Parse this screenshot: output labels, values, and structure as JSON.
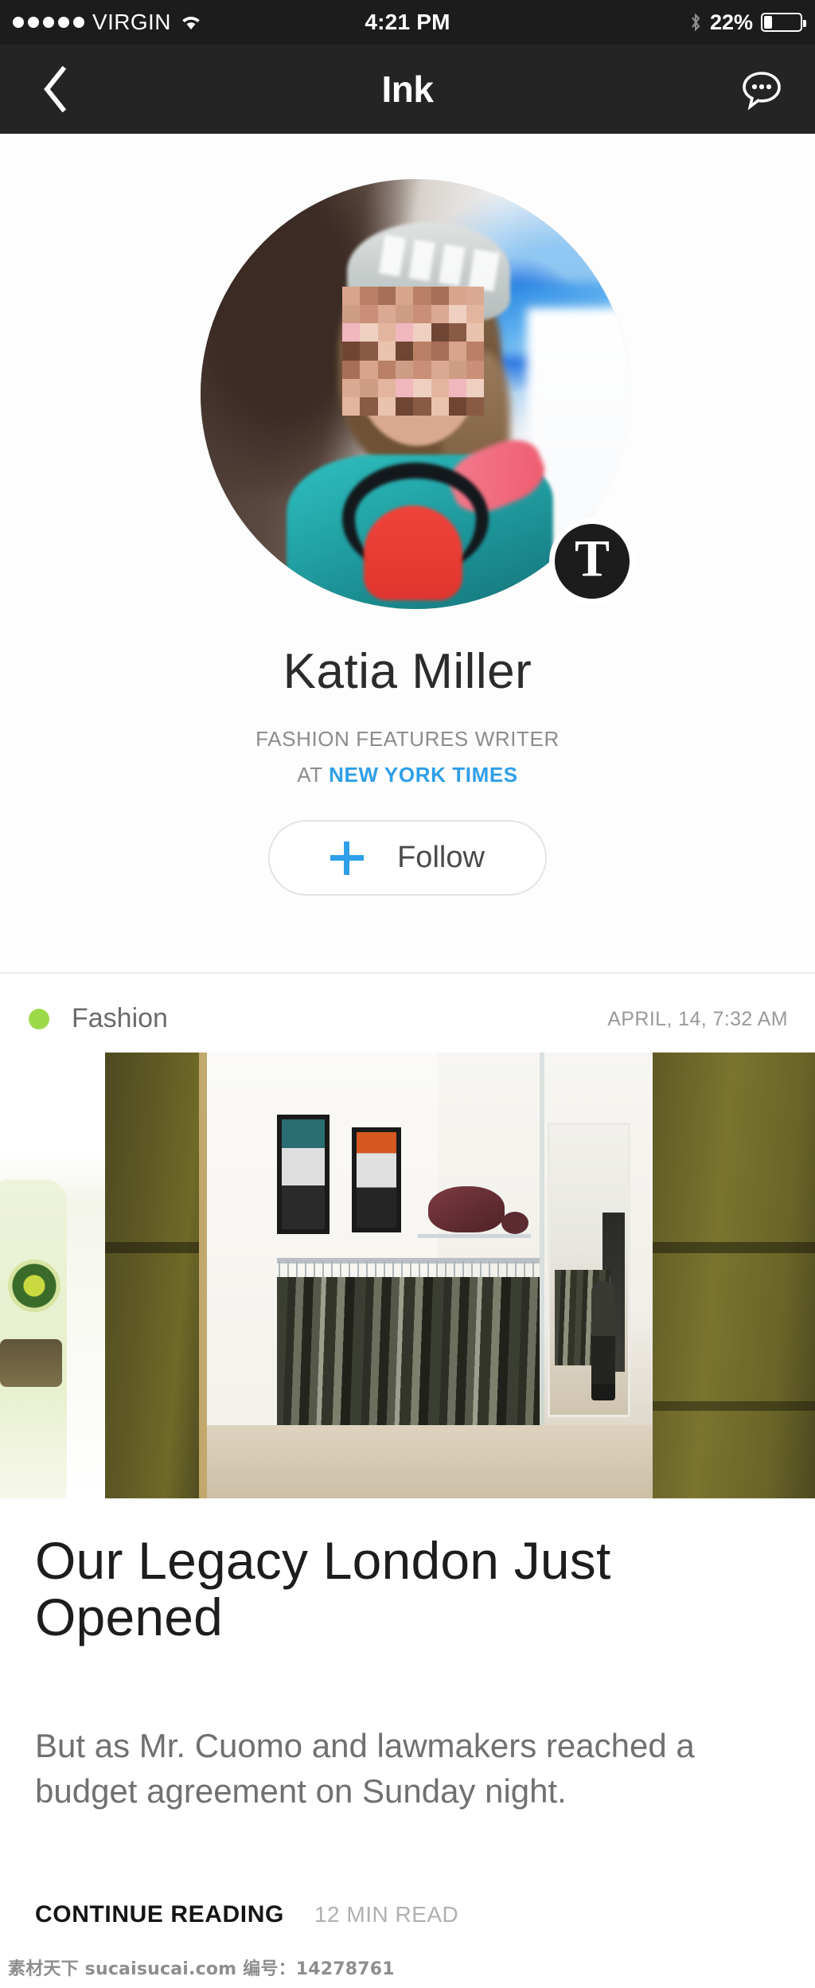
{
  "status_bar": {
    "signal_dots": 5,
    "carrier": "VIRGIN",
    "wifi_icon": "wifi-icon",
    "time": "4:21 PM",
    "bluetooth_icon": "bluetooth-icon",
    "battery_percent": "22%",
    "battery_level": 22
  },
  "nav_bar": {
    "back_icon": "chevron-left-icon",
    "title": "Ink",
    "chat_icon": "chat-bubble-icon"
  },
  "profile": {
    "avatar_alt": "avatar-photo",
    "badge_letter": "T",
    "badge_name": "new-york-times-badge",
    "name": "Katia Miller",
    "role": "FASHION FEATURES WRITER",
    "employer_prefix": "AT ",
    "employer": "NEW YORK TIMES",
    "follow_label": "Follow",
    "plus_icon": "plus-icon"
  },
  "article": {
    "category": "Fashion",
    "category_dot_color": "#9ed94a",
    "date": "APRIL, 14,  7:32 AM",
    "image_alt": "boutique-interior-photo",
    "headline": "Our Legacy London Just Opened",
    "excerpt": "But as Mr. Cuomo and lawmakers reached a budget agreement on Sunday night.",
    "continue_label": "CONTINUE READING",
    "read_time": "12 MIN READ"
  },
  "colors": {
    "accent_blue": "#2e9fe8",
    "category_green": "#9ed94a",
    "nav_background": "#242424",
    "status_background": "#1c1c1c"
  },
  "watermark": "素材天下 sucaisucai.com  编号：14278761"
}
